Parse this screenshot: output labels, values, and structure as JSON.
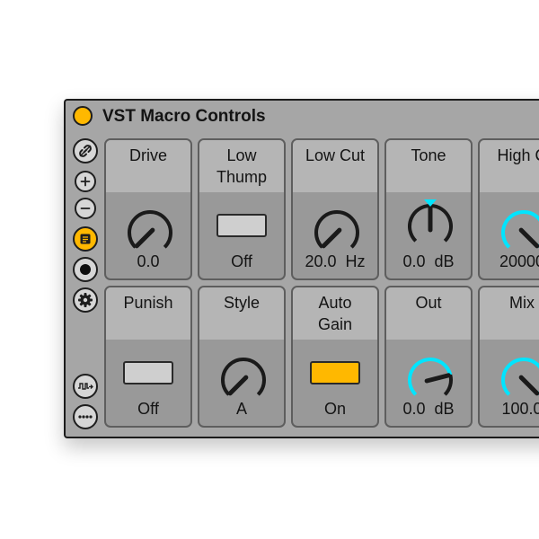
{
  "device": {
    "title": "VST Macro Controls",
    "accent_color": "#ffb800",
    "knob_active_color": "#00e5ff"
  },
  "sidebar": {
    "buttons": [
      {
        "id": "link",
        "icon": "link-icon"
      },
      {
        "id": "add",
        "icon": "plus-icon"
      },
      {
        "id": "remove",
        "icon": "minus-icon"
      },
      {
        "id": "notes",
        "icon": "note-icon",
        "active": true
      },
      {
        "id": "record",
        "icon": "record-icon"
      },
      {
        "id": "settings",
        "icon": "gear-icon"
      },
      {
        "id": "routing",
        "icon": "signal-icon"
      },
      {
        "id": "more",
        "icon": "more-icon"
      }
    ]
  },
  "controls": [
    {
      "label": "Drive",
      "value": "0.0",
      "kind": "knob",
      "level": 0.0,
      "active": false
    },
    {
      "label": "Low\nThump",
      "value": "Off",
      "kind": "toggle",
      "on": false
    },
    {
      "label": "Low Cut",
      "value": "20.0  Hz",
      "kind": "knob",
      "level": 0.0,
      "active": false
    },
    {
      "label": "Tone",
      "value": "0.0  dB",
      "kind": "knob",
      "level": 0.5,
      "active": false,
      "center_marker": true
    },
    {
      "label": "High C",
      "value": "20000",
      "kind": "knob",
      "level": 1.0,
      "active": true
    },
    {
      "label": "Punish",
      "value": "Off",
      "kind": "toggle",
      "on": false
    },
    {
      "label": "Style",
      "value": "A",
      "kind": "knob",
      "level": 0.0,
      "active": false
    },
    {
      "label": "Auto\nGain",
      "value": "On",
      "kind": "toggle",
      "on": true
    },
    {
      "label": "Out",
      "value": "0.0  dB",
      "kind": "knob",
      "level": 0.78,
      "active": true
    },
    {
      "label": "Mix",
      "value": "100.0",
      "kind": "knob",
      "level": 1.0,
      "active": true
    }
  ]
}
